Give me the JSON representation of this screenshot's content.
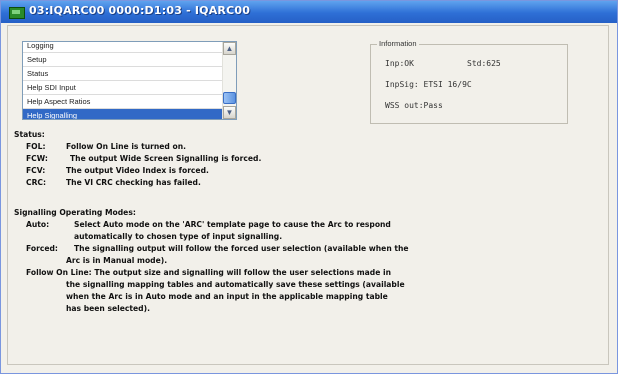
{
  "window": {
    "title": "03:IQARC00  0000:D1:03 - IQARC00"
  },
  "list": {
    "items": [
      "Logging",
      "Setup",
      "Status",
      "Help SDI Input",
      "Help Aspect Ratios",
      "Help Signalling"
    ],
    "selected": "Help Signalling"
  },
  "info": {
    "legend": "Information",
    "imp": "Inp:OK",
    "std": "Std:625",
    "impsig": "InpSig: ETSI 16/9C",
    "wss": "WSS out:Pass"
  },
  "status": {
    "heading": "Status:",
    "rows": [
      {
        "key": "FOL:",
        "text": "Follow On Line is turned on."
      },
      {
        "key": "FCW:",
        "text": "The output Wide Screen Signalling is forced."
      },
      {
        "key": "FCV:",
        "text": "The output Video Index is forced."
      },
      {
        "key": "CRC:",
        "text": "The VI CRC checking has failed."
      }
    ]
  },
  "modes": {
    "heading": "Signalling Operating Modes:",
    "auto_key": "Auto:",
    "auto_line1": "Select Auto mode on the 'ARC' template page to cause the Arc to respond",
    "auto_line2": "automatically to chosen type of input signalling.",
    "forced_key": "Forced:",
    "forced_line1": "The signalling output will follow the forced user selection (available when the",
    "forced_line2": "Arc is in Manual mode).",
    "fol_line1": "Follow On Line: The output size and signalling will follow the user selections made in",
    "fol_line2": "the signalling mapping tables and automatically save these settings (available",
    "fol_line3": "when the Arc is in Auto mode and an input in the applicable mapping table",
    "fol_line4": "has been selected)."
  },
  "colors": {
    "titlebar": "#2e6fd6",
    "selection": "#3169c6",
    "background": "#f2f0ea"
  },
  "icons": {
    "app": "app-window-icon",
    "scroll_up": "chevron-up-icon",
    "scroll_down": "chevron-down-icon"
  }
}
